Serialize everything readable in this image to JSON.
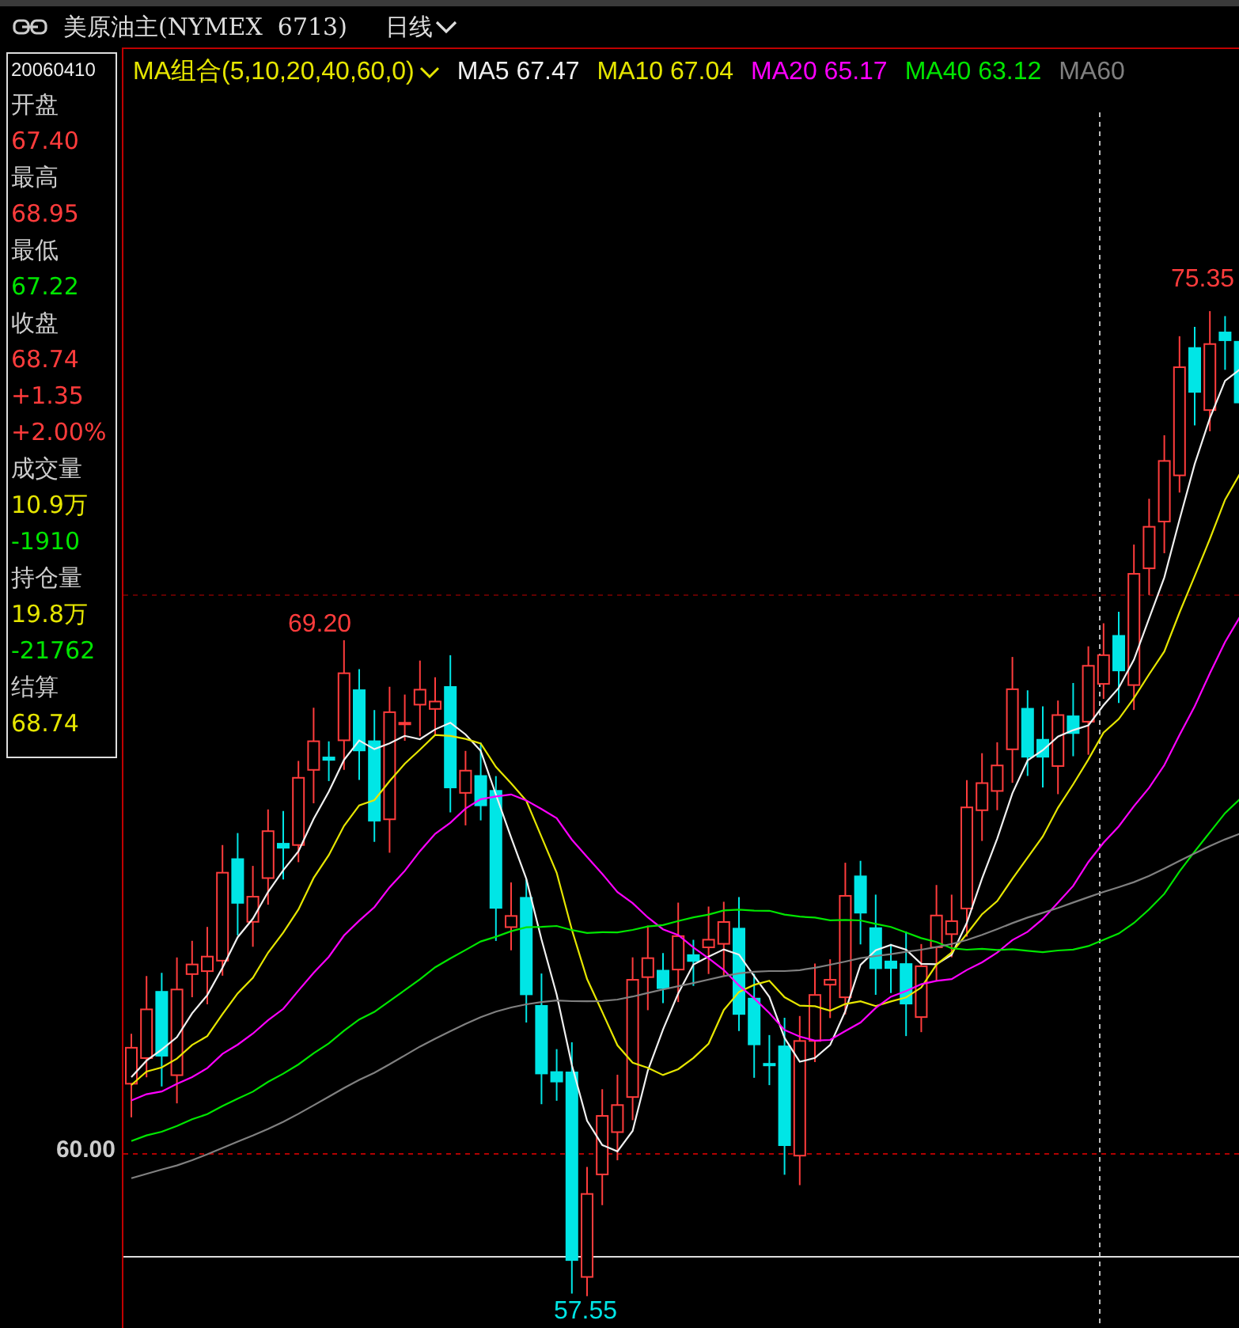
{
  "header": {
    "title": "美原油主(NYMEX  6713)",
    "period": "日线"
  },
  "ma_legend": {
    "label": "MA组合(5,10,20,40,60,0)",
    "items": [
      {
        "text": "MA5 67.47",
        "color": "#f0f0f0"
      },
      {
        "text": "MA10 67.04",
        "color": "#e6e600"
      },
      {
        "text": "MA20 65.17",
        "color": "#ff00ff"
      },
      {
        "text": "MA40 63.12",
        "color": "#00e600"
      },
      {
        "text": "MA60",
        "color": "#808080"
      }
    ]
  },
  "info_panel": {
    "date": "20060410",
    "rows": [
      {
        "text": "开盘",
        "kind": "label"
      },
      {
        "text": "67.40",
        "kind": "value",
        "color": "#ff3c3c"
      },
      {
        "text": "最高",
        "kind": "label"
      },
      {
        "text": "68.95",
        "kind": "value",
        "color": "#ff3c3c"
      },
      {
        "text": "最低",
        "kind": "label"
      },
      {
        "text": "67.22",
        "kind": "value",
        "color": "#00e600"
      },
      {
        "text": "收盘",
        "kind": "label"
      },
      {
        "text": "68.74",
        "kind": "value",
        "color": "#ff3c3c"
      },
      {
        "text": "+1.35",
        "kind": "value",
        "color": "#ff3c3c"
      },
      {
        "text": "+2.00%",
        "kind": "value",
        "color": "#ff3c3c"
      },
      {
        "text": "成交量",
        "kind": "label"
      },
      {
        "text": "10.9万",
        "kind": "value",
        "color": "#e6e600"
      },
      {
        "text": "-1910",
        "kind": "value",
        "color": "#00e600"
      },
      {
        "text": "持仓量",
        "kind": "label"
      },
      {
        "text": "19.8万",
        "kind": "value",
        "color": "#e6e600"
      },
      {
        "text": "-21762",
        "kind": "value",
        "color": "#00e600"
      },
      {
        "text": "结算",
        "kind": "label"
      },
      {
        "text": "68.74",
        "kind": "value",
        "color": "#e6e600"
      }
    ]
  },
  "price_axis": {
    "label": "60.00"
  },
  "price_marks": [
    {
      "text": "69.20",
      "kind": "high"
    },
    {
      "text": "75.35",
      "kind": "high"
    },
    {
      "text": "57.55",
      "kind": "low"
    }
  ]
}
